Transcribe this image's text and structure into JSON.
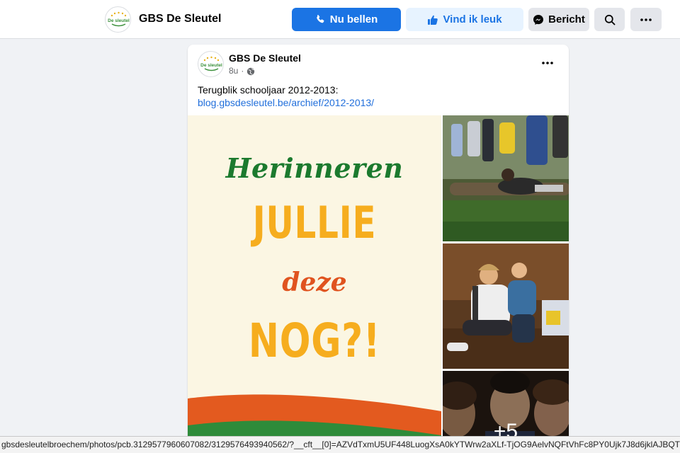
{
  "header": {
    "page_name": "GBS De Sleutel",
    "logo_label": "De sleutel",
    "buttons": {
      "call": "Nu bellen",
      "like": "Vind ik leuk",
      "message": "Bericht"
    },
    "icons": {
      "call": "phone-icon",
      "like": "thumbs-up-icon",
      "message": "messenger-icon",
      "search": "search-icon",
      "more": "more-icon"
    }
  },
  "post": {
    "author": "GBS De Sleutel",
    "time": "8u",
    "audience_icon": "globe-icon",
    "text": "Terugblik schooljaar 2012-2013:",
    "link": "blog.gbsdesleutel.be/archief/2012-2013/",
    "image_main": {
      "line1": "Herinneren",
      "line2": "JULLIE",
      "line3": "deze",
      "line4": "NOG?!"
    },
    "more_photos": "+5"
  },
  "status_bar": {
    "url": "gbsdesleutelbroechem/photos/pcb.3129577960607082/3129576493940562/?__cft__[0]=AZVdTxmU5UF448LuogXsA0kYTWrw2aXLf-TjOG9AelvNQFtVhFc8PY0Ujk7J8d6jklAJBQTlsR69MyFqsMZZ-HWQB"
  },
  "colors": {
    "primary": "#1b74e4",
    "like_bg": "#e7f3ff",
    "link": "#216fdb",
    "headline_green": "#1b7a2e",
    "headline_yellow": "#f6ad1e",
    "headline_orange": "#e0531f"
  }
}
